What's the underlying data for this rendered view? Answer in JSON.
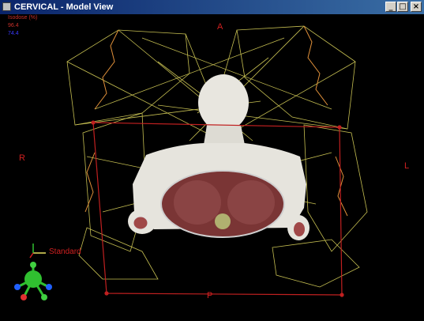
{
  "window": {
    "title": "CERVICAL  - Model View",
    "buttons": {
      "minimize": "_",
      "maximize": "□",
      "close": "×"
    }
  },
  "legend": {
    "title": "Isodose (%)",
    "values": [
      "96.4",
      "74.4"
    ],
    "colors": [
      "#c8302a",
      "#3a3aff"
    ]
  },
  "orientation": {
    "anterior": "A",
    "posterior": "P",
    "right": "R",
    "left": "L"
  },
  "view_label": "Standard",
  "colors": {
    "beams": "#e8e060",
    "field_box": "#c02020",
    "skin": "#e8e6df",
    "organ": "#8a3c3c",
    "marker": "#30c030"
  },
  "icons": {
    "app": "app-icon",
    "axis": "axis-triad-icon",
    "orientation_widget": "orientation-sphere-icon"
  }
}
